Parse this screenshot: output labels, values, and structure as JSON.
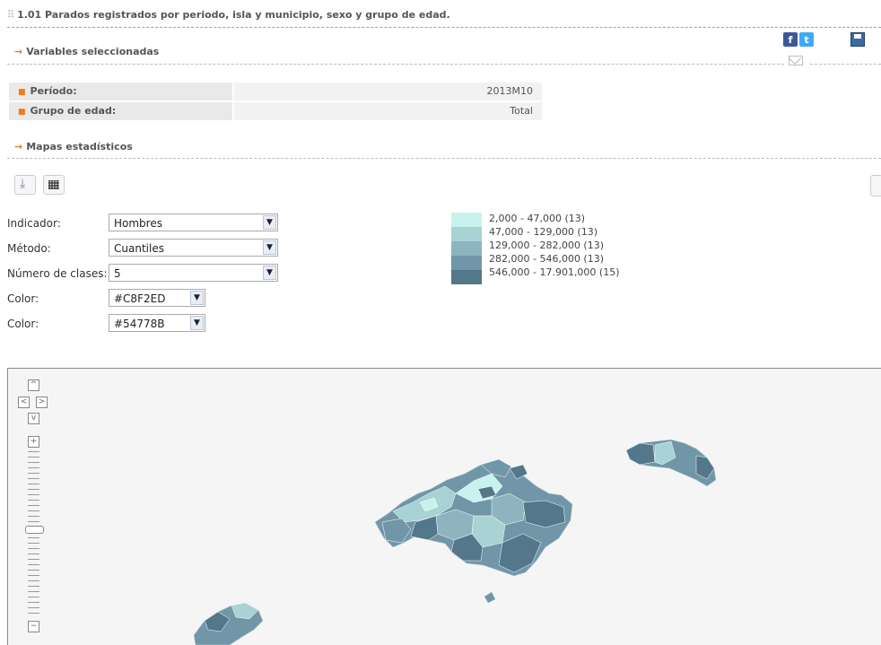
{
  "page": {
    "title": "1.01 Parados registrados por periodo, isla y municipio, sexo y grupo de edad."
  },
  "sections": {
    "variables": "Variables seleccionadas",
    "maps": "Mapas estadísticos"
  },
  "variables": [
    {
      "label": "Período:",
      "value": "2013M10"
    },
    {
      "label": "Grupo de edad:",
      "value": "Total"
    }
  ],
  "social": {
    "facebook_glyph": "f",
    "twitter_glyph": "t"
  },
  "form": {
    "indicador": {
      "label": "Indicador:",
      "value": "Hombres"
    },
    "metodo": {
      "label": "Método:",
      "value": "Cuantiles"
    },
    "clases": {
      "label": "Número de clases:",
      "value": "5"
    },
    "color1": {
      "label": "Color:",
      "value": "#C8F2ED"
    },
    "color2": {
      "label": "Color:",
      "value": "#54778B"
    }
  },
  "legend": [
    {
      "text": "2,000 - 47,000 (13)",
      "color": "#C8F2ED"
    },
    {
      "text": "47,000 - 129,000 (13)",
      "color": "#A8D2D4"
    },
    {
      "text": "129,000 - 282,000 (13)",
      "color": "#8EB4BF"
    },
    {
      "text": "282,000 - 546,000 (13)",
      "color": "#7196A8"
    },
    {
      "text": "546,000 - 17.901,000 (15)",
      "color": "#54778B"
    }
  ],
  "map": {
    "nav_up_glyph": "^",
    "nav_left_glyph": "<",
    "nav_right_glyph": ">",
    "nav_down_glyph": "v",
    "zoom_in_glyph": "+",
    "zoom_out_glyph": "−"
  },
  "colors": {
    "accent": "#f07a1a",
    "background_map": "#f5f5f5",
    "low": "#C8F2ED",
    "high": "#54778B"
  }
}
